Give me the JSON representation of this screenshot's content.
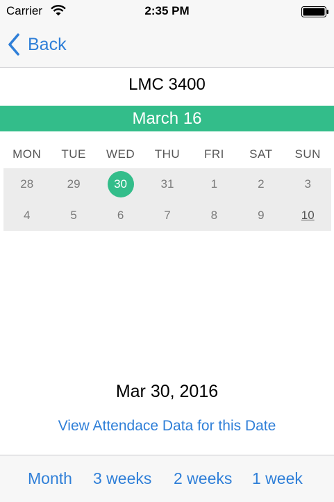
{
  "status_bar": {
    "carrier": "Carrier",
    "time": "2:35 PM"
  },
  "nav": {
    "back_label": "Back"
  },
  "course": {
    "title": "LMC 3400"
  },
  "banner": {
    "label": "March 16",
    "color": "#33bd8a"
  },
  "calendar": {
    "weekdays": [
      "MON",
      "TUE",
      "WED",
      "THU",
      "FRI",
      "SAT",
      "SUN"
    ],
    "weeks": [
      [
        "28",
        "29",
        "30",
        "31",
        "1",
        "2",
        "3"
      ],
      [
        "4",
        "5",
        "6",
        "7",
        "8",
        "9",
        "10"
      ]
    ],
    "selected_day": "30",
    "underlined_day": "10"
  },
  "selection": {
    "date_text": "Mar 30, 2016",
    "link_text": "View Attendace Data for this Date"
  },
  "toolbar": {
    "options": [
      "Month",
      "3 weeks",
      "2 weeks",
      "1 week"
    ]
  },
  "colors": {
    "accent": "#33bd8a",
    "link": "#2f7fd8"
  },
  "icons": {
    "wifi": "wifi-icon",
    "battery": "battery-icon",
    "back": "chevron-left-icon"
  }
}
